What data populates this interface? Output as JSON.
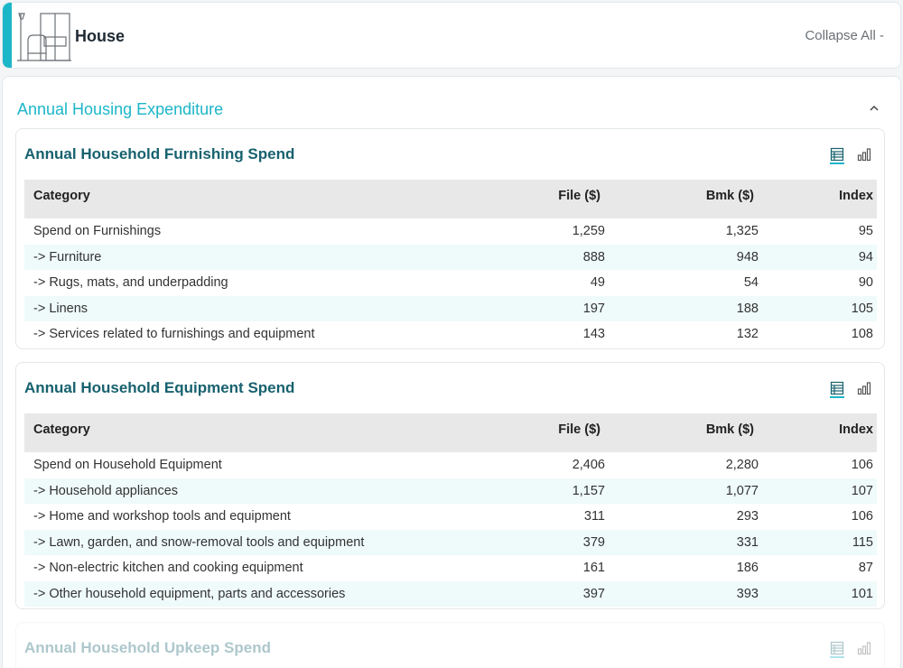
{
  "header": {
    "title": "House",
    "collapse_label": "Collapse All -"
  },
  "section": {
    "title": "Annual Housing Expenditure"
  },
  "columns": {
    "category": "Category",
    "file": "File ($)",
    "bmk": "Bmk ($)",
    "index": "Index"
  },
  "panels": [
    {
      "title": "Annual Household Furnishing Spend",
      "rows": [
        {
          "category": "Spend on Furnishings",
          "file": "1,259",
          "bmk": "1,325",
          "index": "95"
        },
        {
          "category": "-> Furniture",
          "file": "888",
          "bmk": "948",
          "index": "94"
        },
        {
          "category": "-> Rugs, mats, and underpadding",
          "file": "49",
          "bmk": "54",
          "index": "90"
        },
        {
          "category": "-> Linens",
          "file": "197",
          "bmk": "188",
          "index": "105"
        },
        {
          "category": "-> Services related to furnishings and equipment",
          "file": "143",
          "bmk": "132",
          "index": "108"
        }
      ]
    },
    {
      "title": "Annual Household Equipment Spend",
      "rows": [
        {
          "category": "Spend on Household Equipment",
          "file": "2,406",
          "bmk": "2,280",
          "index": "106"
        },
        {
          "category": "-> Household appliances",
          "file": "1,157",
          "bmk": "1,077",
          "index": "107"
        },
        {
          "category": "-> Home and workshop tools and equipment",
          "file": "311",
          "bmk": "293",
          "index": "106"
        },
        {
          "category": "-> Lawn, garden, and snow-removal tools and equipment",
          "file": "379",
          "bmk": "331",
          "index": "115"
        },
        {
          "category": "-> Non-electric kitchen and cooking equipment",
          "file": "161",
          "bmk": "186",
          "index": "87"
        },
        {
          "category": "-> Other household equipment, parts and accessories",
          "file": "397",
          "bmk": "393",
          "index": "101"
        }
      ]
    },
    {
      "title": "Annual Household Upkeep Spend",
      "rows": []
    }
  ],
  "icons": {
    "header": "house-furniture-icon",
    "table_view": "table-view-icon",
    "chart_view": "bar-chart-icon",
    "section_toggle": "chevron-up-icon"
  },
  "colors": {
    "accent": "#1cb6c9",
    "panel_title": "#17616e",
    "row_stripe": "#effafa",
    "header_bg": "#e8e8e8"
  }
}
